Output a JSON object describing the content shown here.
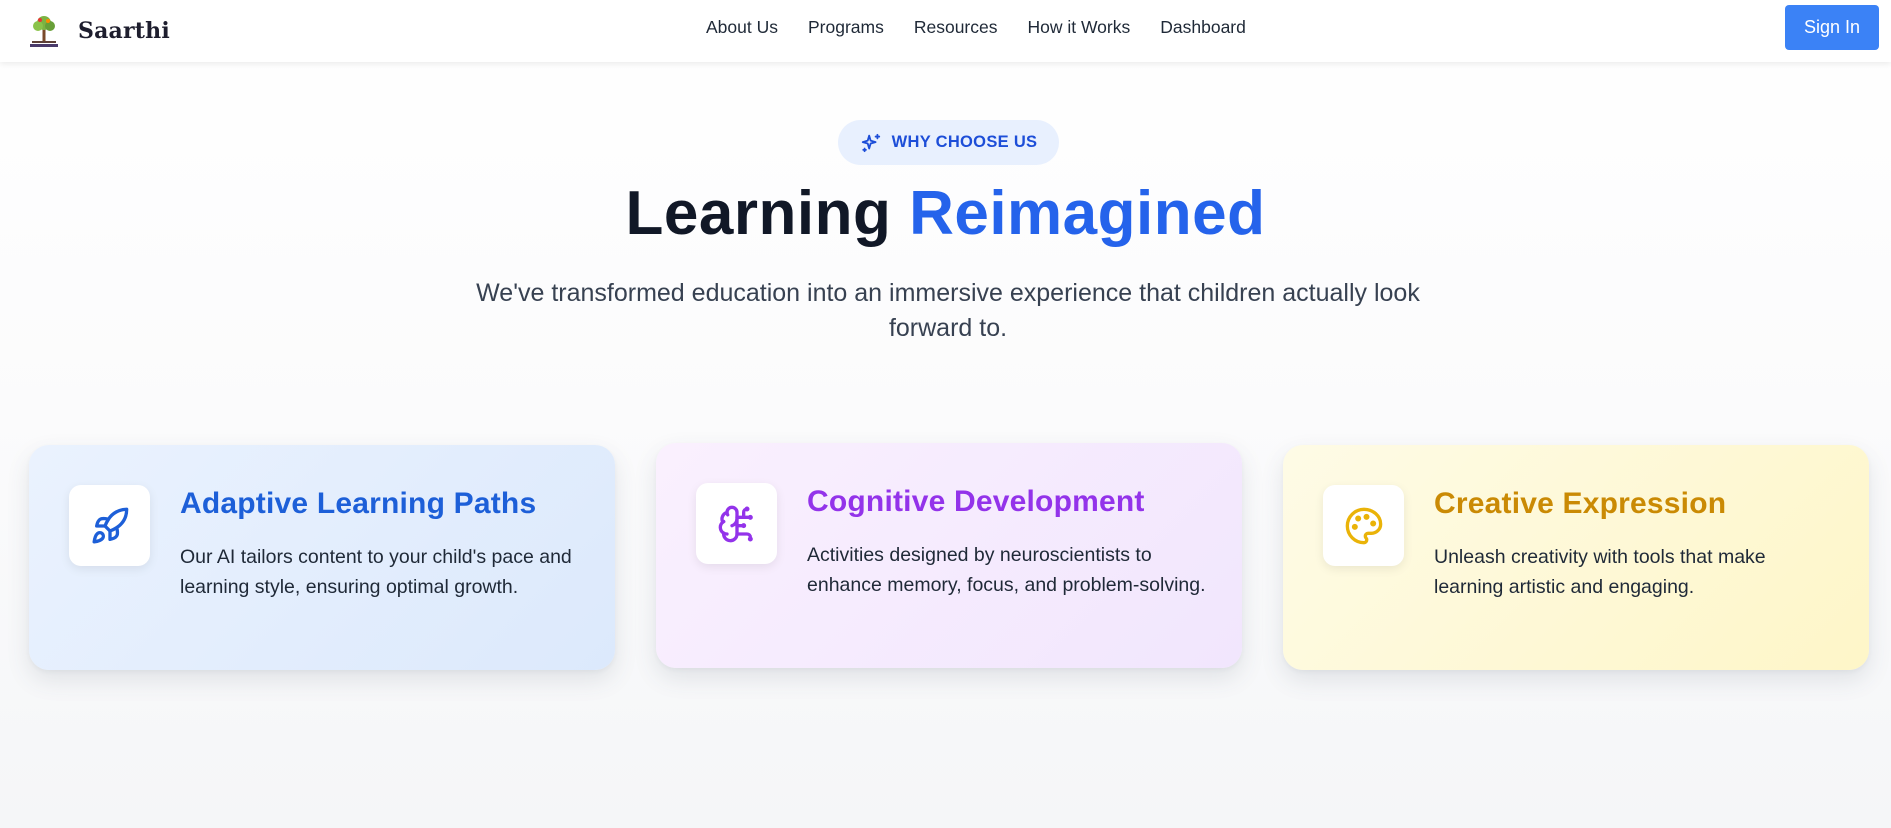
{
  "header": {
    "brand_name": "Saarthi",
    "nav": [
      "About Us",
      "Programs",
      "Resources",
      "How it Works",
      "Dashboard"
    ],
    "signin_label": "Sign In"
  },
  "hero": {
    "badge": "WHY CHOOSE US",
    "title_main": "Learning",
    "title_accent": "Reimagined",
    "subtitle": "We've transformed education into an immersive experience that children actually look forward to."
  },
  "features": [
    {
      "title": "Adaptive Learning Paths",
      "description": "Our AI tailors content to your child's pace and learning style, ensuring optimal growth.",
      "icon": "rocket-icon",
      "color": "#1d5fd8"
    },
    {
      "title": "Cognitive Development",
      "description": "Activities designed by neuroscientists to enhance memory, focus, and problem-solving.",
      "icon": "brain-icon",
      "color": "#9333ea"
    },
    {
      "title": "Creative Expression",
      "description": "Unleash creativity with tools that make learning artistic and engaging.",
      "icon": "palette-icon",
      "color": "#ca8a04"
    }
  ],
  "colors": {
    "accent": "#2563eb",
    "signin": "#3b82f6"
  }
}
